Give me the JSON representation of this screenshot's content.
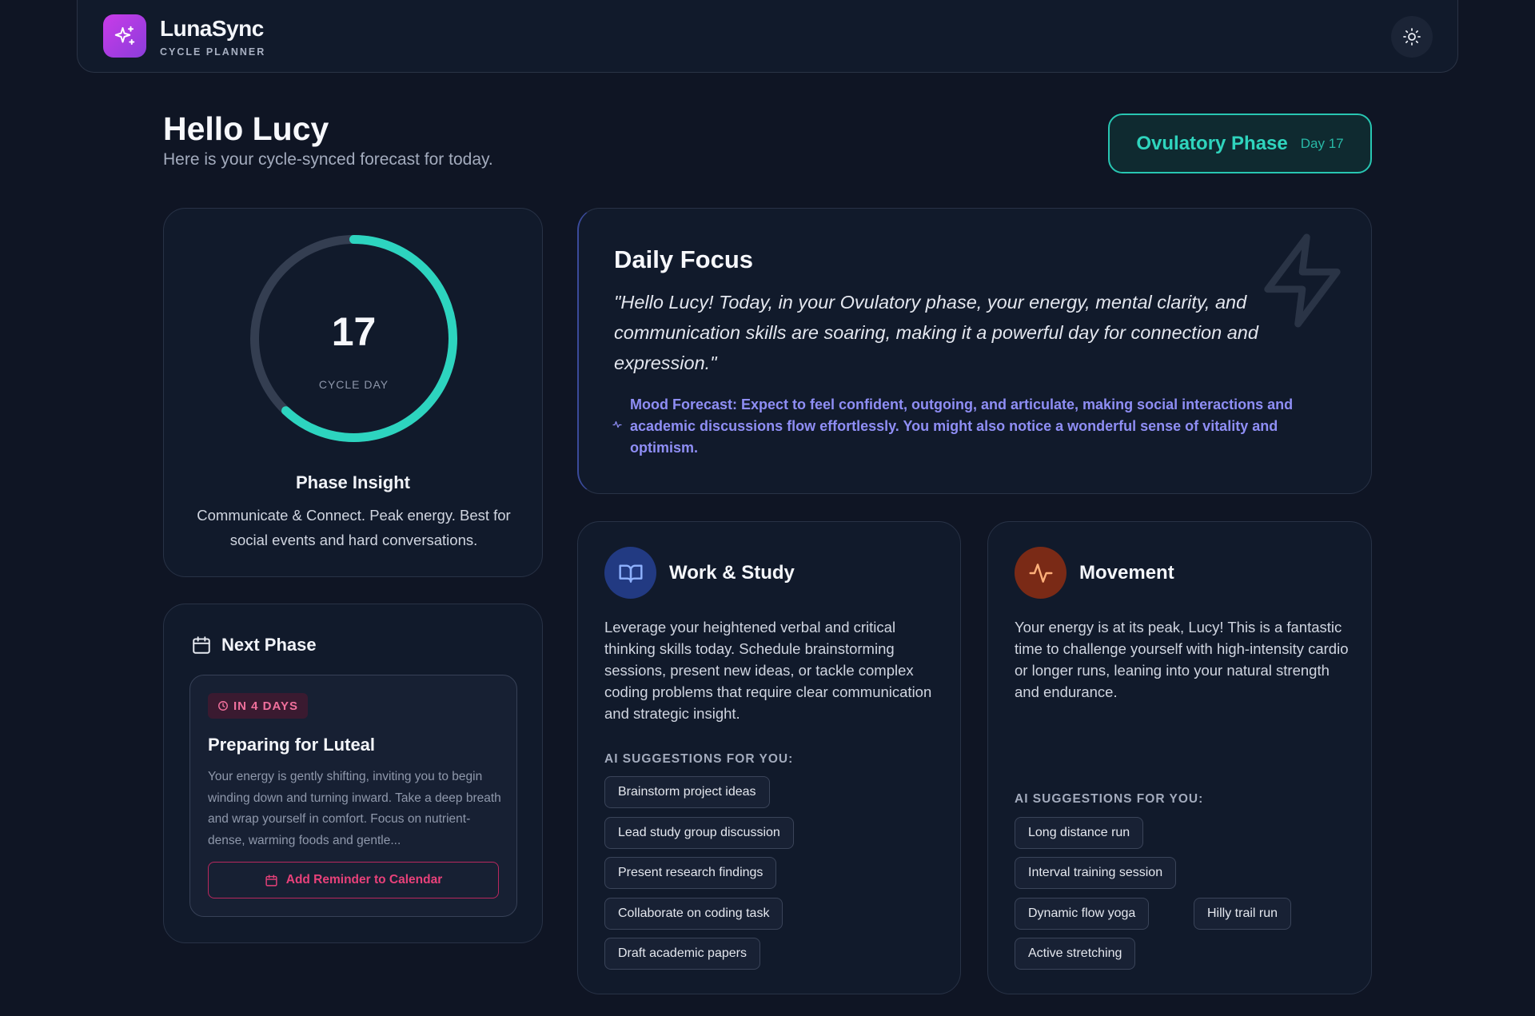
{
  "header": {
    "app_name": "LunaSync",
    "app_subtitle": "CYCLE PLANNER",
    "logo_icon": "sparkles-icon",
    "theme_icon": "sun-icon"
  },
  "greeting": {
    "title": "Hello Lucy",
    "subtitle": "Here is your cycle-synced forecast for today."
  },
  "phase_badge": {
    "phase": "Ovulatory Phase",
    "day": "Day 17"
  },
  "cycle_ring": {
    "day": "17",
    "label": "CYCLE DAY",
    "progress": 0.62,
    "insight_title": "Phase Insight",
    "insight_text": "Communicate & Connect. Peak energy. Best for social events and hard conversations."
  },
  "next_phase": {
    "title": "Next Phase",
    "countdown": "IN 4 DAYS",
    "heading": "Preparing for Luteal",
    "text": "Your energy is gently shifting, inviting you to begin winding down and turning inward. Take a deep breath and wrap yourself in comfort. Focus on nutrient-dense, warming foods and gentle...",
    "button": "Add Reminder to Calendar"
  },
  "daily_focus": {
    "title": "Daily Focus",
    "quote": "\"Hello Lucy! Today, in your Ovulatory phase, your energy, mental clarity, and communication skills are soaring, making it a powerful day for connection and expression.\"",
    "mood": "Mood Forecast: Expect to feel confident, outgoing, and articulate, making social interactions and academic discussions flow effortlessly. You might also notice a wonderful sense of vitality and optimism."
  },
  "work": {
    "title": "Work & Study",
    "text": "Leverage your heightened verbal and critical thinking skills today. Schedule brainstorming sessions, present new ideas, or tackle complex coding problems that require clear communication and strategic insight.",
    "suggestions_label": "AI SUGGESTIONS FOR YOU:",
    "suggestions": [
      "Brainstorm project ideas",
      "Lead study group discussion",
      "Present research findings",
      "Collaborate on coding task",
      "Draft academic papers"
    ]
  },
  "movement": {
    "title": "Movement",
    "text": "Your energy is at its peak, Lucy! This is a fantastic time to challenge yourself with high-intensity cardio or longer runs, leaning into your natural strength and endurance.",
    "suggestions_label": "AI SUGGESTIONS FOR YOU:",
    "suggestions": [
      "Long distance run",
      "Interval training session",
      "Dynamic flow yoga",
      "Hilly trail run",
      "Active stretching"
    ]
  },
  "colors": {
    "accent_teal": "#2dd4bf",
    "accent_pink": "#e8417a",
    "accent_indigo": "#8f8ef5",
    "background": "#0f1524"
  }
}
